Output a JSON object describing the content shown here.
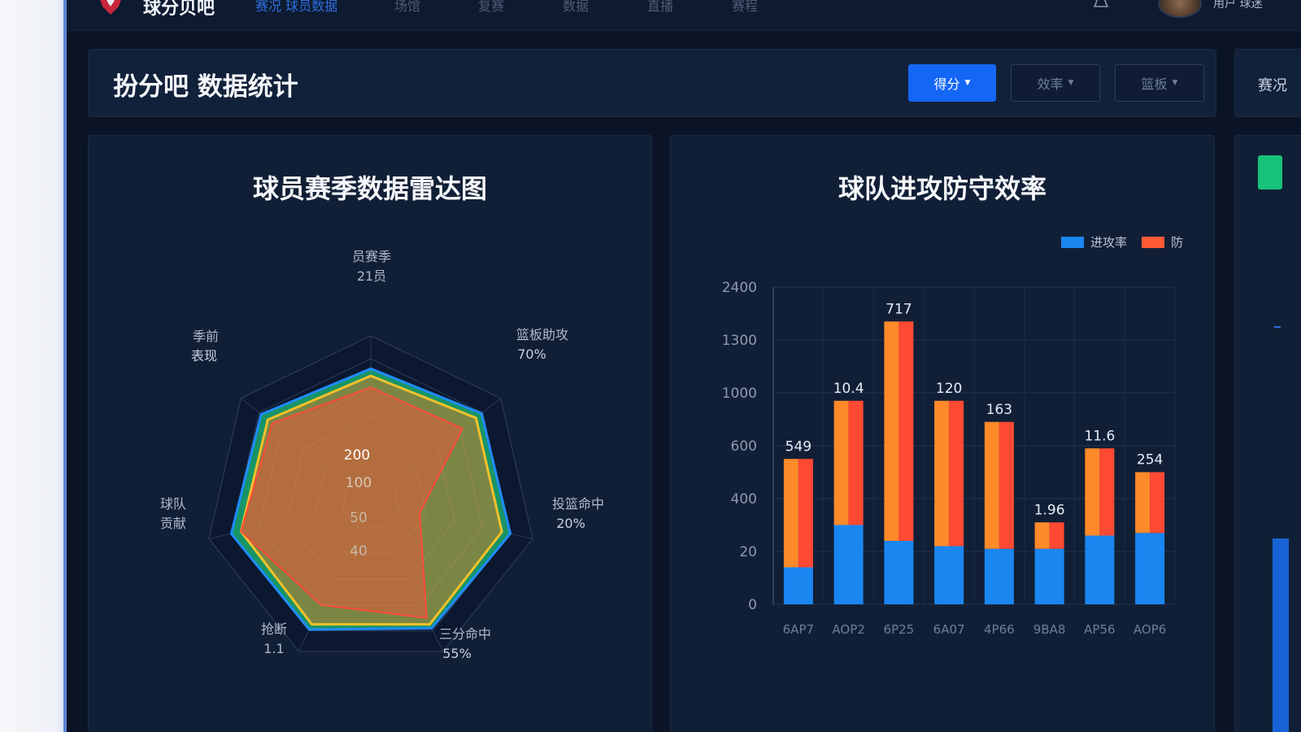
{
  "app": {
    "brand": "球分贝吧",
    "nav_active": "赛况 球员数据",
    "nav_items": [
      "场馆",
      "复赛",
      "数据",
      "直播",
      "赛程"
    ],
    "user_name": "用户 球迷"
  },
  "header": {
    "title": "扮分吧 数据统计",
    "buttons": [
      {
        "label": "得分",
        "active": true
      },
      {
        "label": "效率",
        "active": false
      },
      {
        "label": "篮板",
        "active": false
      }
    ],
    "side_label": "赛况"
  },
  "colors": {
    "accent_blue": "#1466f5",
    "bar_blue": "#1a86f0",
    "bar_orange": "#ff8a2a",
    "bar_red": "#ff4a33",
    "radar_green": "#1aa36b",
    "radar_yellow": "#f3c12a",
    "side_green": "#18c27a"
  },
  "icons": {
    "logo": "shield-logo-icon",
    "bell": "bell-icon",
    "caret": "caret-down-icon"
  },
  "radar_panel": {
    "title": "球员赛季数据雷达图",
    "axes": [
      {
        "name": "员赛季",
        "value": "21员"
      },
      {
        "name": "篮板助攻",
        "value": "70%"
      },
      {
        "name": "投篮命中",
        "value": "20%"
      },
      {
        "name": "三分命中",
        "value": "55%"
      },
      {
        "name": "抢断",
        "value": "1.1"
      },
      {
        "name": "球队",
        "value": "贡献"
      },
      {
        "name": "季前",
        "value": "表现"
      }
    ],
    "ring_labels": [
      "200",
      "100",
      "50",
      "40"
    ]
  },
  "bar_panel": {
    "title": "球队进攻防守效率",
    "legend": [
      "进攻率",
      "防"
    ]
  },
  "chart_data": [
    {
      "type": "radar",
      "title": "球员赛季数据雷达图",
      "axes": [
        "员赛季",
        "篮板助攻",
        "投篮命中",
        "三分命中",
        "抢断",
        "球队",
        "季前"
      ],
      "rings": [
        40,
        50,
        100,
        200
      ],
      "series": [
        {
          "values": [
            0.93,
            0.99,
            1.0,
            0.98,
            0.99,
            1.0,
            0.98
          ]
        },
        {
          "values": [
            0.88,
            0.94,
            0.94,
            0.95,
            0.95,
            0.93,
            0.92
          ]
        },
        {
          "values": [
            0.8,
            0.82,
            0.35,
            0.9,
            0.8,
            0.93,
            0.88
          ]
        }
      ]
    },
    {
      "type": "bar",
      "stacked": true,
      "title": "球队进攻防守效率",
      "categories": [
        "6AP7",
        "AOP2",
        "6P25",
        "6A07",
        "4P66",
        "9BA8",
        "AP56",
        "AOP6"
      ],
      "yticks": [
        "0",
        "20",
        "400",
        "600",
        "1000",
        "1300",
        "2400"
      ],
      "series": [
        {
          "name": "进攻率",
          "values": [
            0.7,
            1.5,
            1.2,
            1.1,
            1.05,
            1.05,
            1.3,
            1.35
          ]
        },
        {
          "name": "防",
          "values": [
            2.05,
            2.35,
            4.15,
            2.75,
            2.4,
            0.5,
            1.65,
            1.15
          ]
        }
      ],
      "labels": [
        "549",
        "10.4",
        "717",
        "120",
        "163",
        "1.96",
        "11.6",
        "254"
      ]
    }
  ]
}
